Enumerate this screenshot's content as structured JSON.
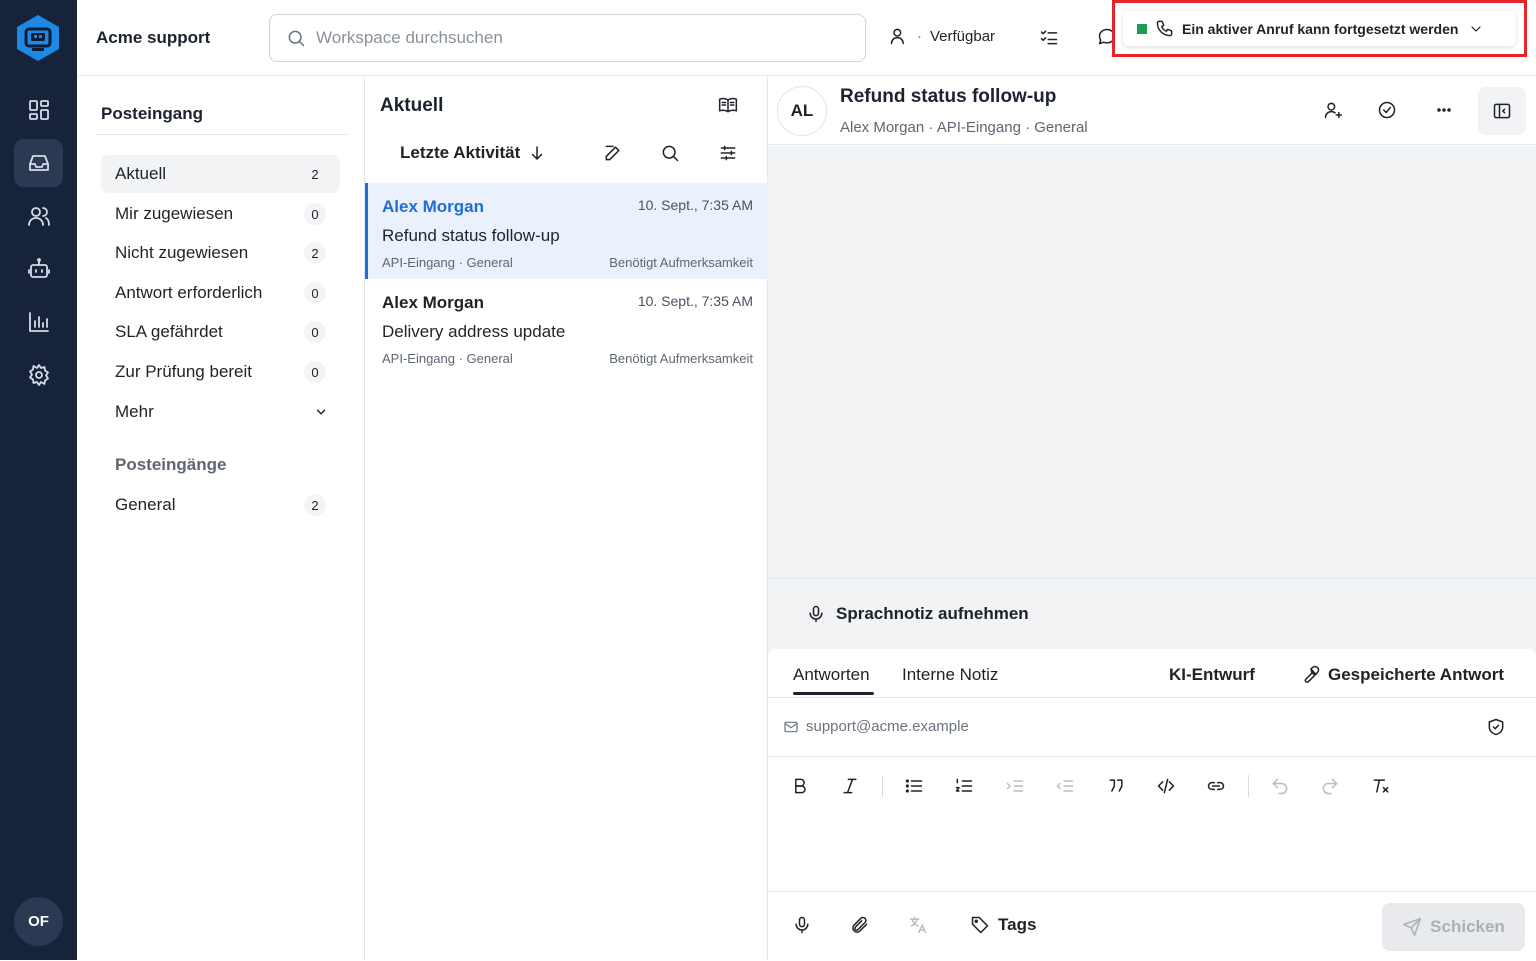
{
  "rail": {
    "avatar_initials": "OF",
    "nav_icons": [
      "dashboard-icon",
      "inbox-icon",
      "contacts-icon",
      "bot-icon",
      "reports-icon",
      "settings-icon"
    ],
    "active": "inbox-icon"
  },
  "topbar": {
    "app_title": "Acme support",
    "search_placeholder": "Workspace durchsuchen",
    "presence_label": "Verfügbar",
    "call_banner": {
      "text": "Ein aktiver Anruf kann fortgesetzt werden",
      "status_color": "#1f9d55",
      "highlight_color": "#e5252a"
    }
  },
  "sidebar": {
    "heading": "Posteingang",
    "items": [
      {
        "label": "Aktuell",
        "count": "2",
        "active": true
      },
      {
        "label": "Mir zugewiesen",
        "count": "0"
      },
      {
        "label": "Nicht zugewiesen",
        "count": "2"
      },
      {
        "label": "Antwort erforderlich",
        "count": "0"
      },
      {
        "label": "SLA gefährdet",
        "count": "0"
      },
      {
        "label": "Zur Prüfung bereit",
        "count": "0"
      },
      {
        "label": "Mehr"
      }
    ],
    "inboxes_heading": "Posteingänge",
    "inboxes": [
      {
        "label": "General",
        "count": "2"
      }
    ]
  },
  "list": {
    "title": "Aktuell",
    "sort_label": "Letzte Aktivität",
    "conversations": [
      {
        "name": "Alex Morgan",
        "time": "10. Sept., 7:35 AM",
        "subject": "Refund status follow-up",
        "meta": "API-Eingang · General",
        "status": "Benötigt Aufmerksamkeit",
        "selected": true
      },
      {
        "name": "Alex Morgan",
        "time": "10. Sept., 7:35 AM",
        "subject": "Delivery address update",
        "meta": "API-Eingang · General",
        "status": "Benötigt Aufmerksamkeit"
      }
    ]
  },
  "detail": {
    "avatar_initials": "AL",
    "subject": "Refund status follow-up",
    "meta": "Alex Morgan  ·  API-Eingang  ·  General"
  },
  "composer": {
    "voice_note_label": "Sprachnotiz aufnehmen",
    "tabs": {
      "reply": "Antworten",
      "internal_note": "Interne Notiz",
      "ai_draft": "KI-Entwurf",
      "saved_reply": "Gespeicherte Antwort"
    },
    "from_address": "support@acme.example",
    "tags_label": "Tags",
    "send_label": "Schicken",
    "accent_color": "#1d6fd6"
  }
}
